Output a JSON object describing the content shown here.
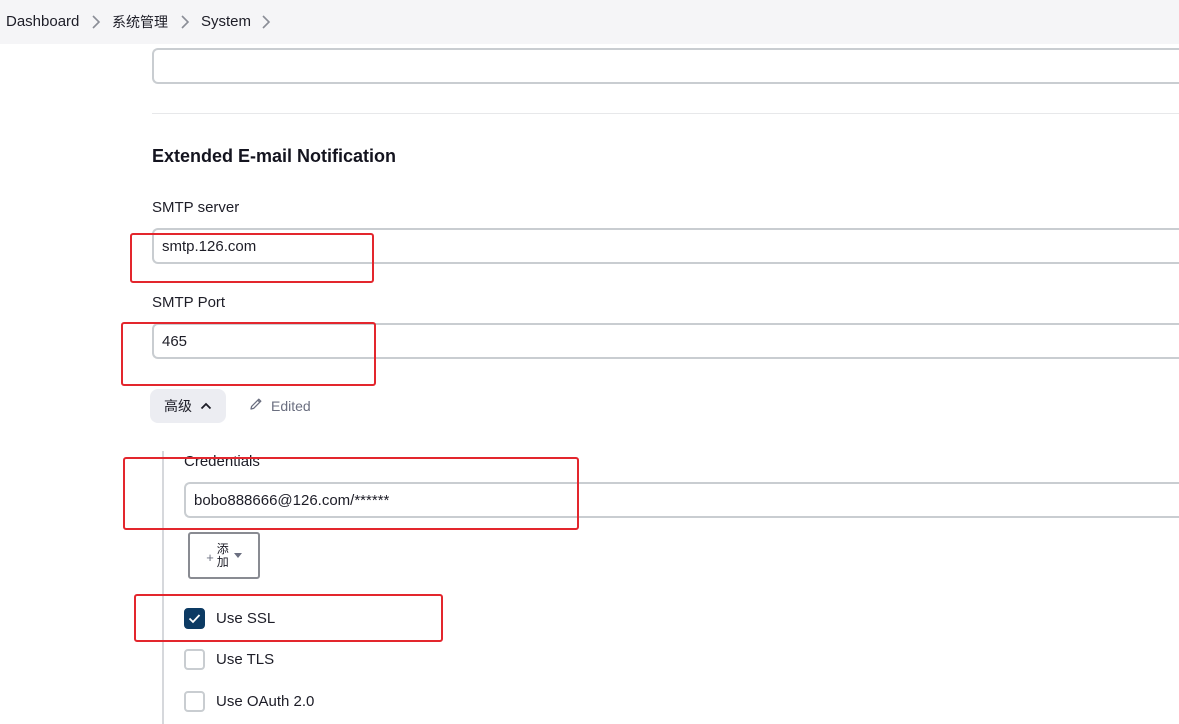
{
  "breadcrumb": {
    "items": [
      "Dashboard",
      "系统管理",
      "System"
    ]
  },
  "section": {
    "title": "Extended E-mail Notification"
  },
  "fields": {
    "smtp_server": {
      "label": "SMTP server",
      "value": "smtp.126.com"
    },
    "smtp_port": {
      "label": "SMTP Port",
      "value": "465"
    },
    "credentials": {
      "label": "Credentials",
      "value": "bobo888666@126.com/******"
    }
  },
  "advanced": {
    "button_label": "高级",
    "edited_label": "Edited"
  },
  "add_button": {
    "label": "添加"
  },
  "options": {
    "use_ssl": {
      "label": "Use SSL",
      "checked": true
    },
    "use_tls": {
      "label": "Use TLS",
      "checked": false
    },
    "use_oauth": {
      "label": "Use OAuth 2.0",
      "checked": false
    }
  },
  "colors": {
    "highlight": "#e3262d",
    "checkbox_checked": "#0c3a63",
    "breadcrumb_bg": "#f5f5f7"
  },
  "icons": {
    "breadcrumb_separator": "chevron-right-icon",
    "advanced_toggle": "chevron-up-icon",
    "edited": "pencil-icon",
    "add": "plus-icon",
    "add_dropdown": "caret-down-icon",
    "checkmark": "check-icon"
  }
}
